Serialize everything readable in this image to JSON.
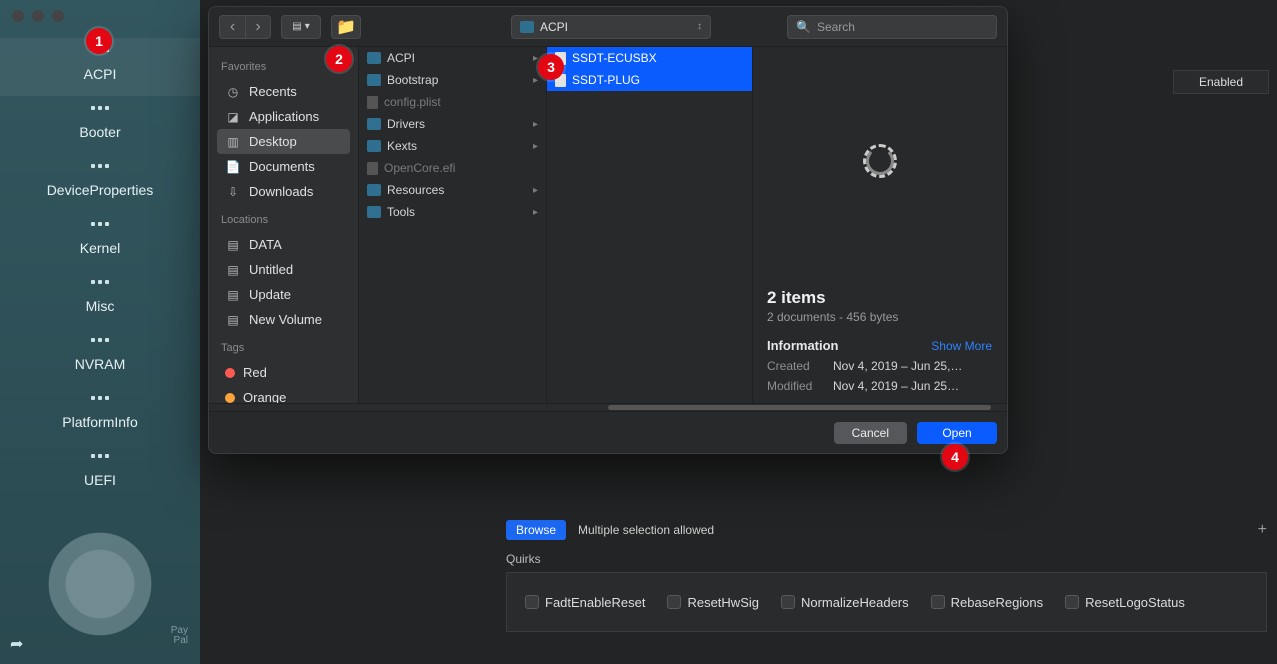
{
  "sidebar": {
    "items": [
      {
        "label": "ACPI"
      },
      {
        "label": "Booter"
      },
      {
        "label": "DeviceProperties"
      },
      {
        "label": "Kernel"
      },
      {
        "label": "Misc"
      },
      {
        "label": "NVRAM"
      },
      {
        "label": "PlatformInfo"
      },
      {
        "label": "UEFI"
      }
    ],
    "paypal_line1": "Pay",
    "paypal_line2": "Pal"
  },
  "main": {
    "enabled_header": "Enabled",
    "browse_label": "Browse",
    "browse_hint": "Multiple selection allowed",
    "quirks_label": "Quirks",
    "quirks": [
      "FadtEnableReset",
      "ResetHwSig",
      "NormalizeHeaders",
      "RebaseRegions",
      "ResetLogoStatus"
    ]
  },
  "dialog": {
    "path_label": "ACPI",
    "search_placeholder": "Search",
    "favorites_header": "Favorites",
    "favorites": [
      {
        "label": "Recents",
        "icon": "clock"
      },
      {
        "label": "Applications",
        "icon": "app"
      },
      {
        "label": "Desktop",
        "icon": "desktop",
        "selected": true
      },
      {
        "label": "Documents",
        "icon": "doc"
      },
      {
        "label": "Downloads",
        "icon": "download"
      }
    ],
    "locations_header": "Locations",
    "locations": [
      {
        "label": "DATA"
      },
      {
        "label": "Untitled"
      },
      {
        "label": "Update"
      },
      {
        "label": "New Volume"
      }
    ],
    "tags_header": "Tags",
    "tags": [
      {
        "label": "Red",
        "color": "#ff5a52"
      },
      {
        "label": "Orange",
        "color": "#fca33b"
      }
    ],
    "column1": [
      {
        "label": "ACPI",
        "type": "folder"
      },
      {
        "label": "Bootstrap",
        "type": "folder"
      },
      {
        "label": "config.plist",
        "type": "doc",
        "dim": true
      },
      {
        "label": "Drivers",
        "type": "folder"
      },
      {
        "label": "Kexts",
        "type": "folder"
      },
      {
        "label": "OpenCore.efi",
        "type": "doc",
        "dim": true
      },
      {
        "label": "Resources",
        "type": "folder"
      },
      {
        "label": "Tools",
        "type": "folder"
      }
    ],
    "column2": [
      {
        "label": "SSDT-ECUSBX",
        "selected": true
      },
      {
        "label": "SSDT-PLUG",
        "selected": true
      }
    ],
    "preview": {
      "title": "2 items",
      "subtitle": "2 documents - 456 bytes",
      "info_label": "Information",
      "show_more": "Show More",
      "created_k": "Created",
      "created_v": "Nov 4, 2019 – Jun 25,…",
      "modified_k": "Modified",
      "modified_v": "Nov 4, 2019 – Jun 25…"
    },
    "cancel_label": "Cancel",
    "open_label": "Open"
  },
  "callouts": [
    "1",
    "2",
    "3",
    "4"
  ]
}
